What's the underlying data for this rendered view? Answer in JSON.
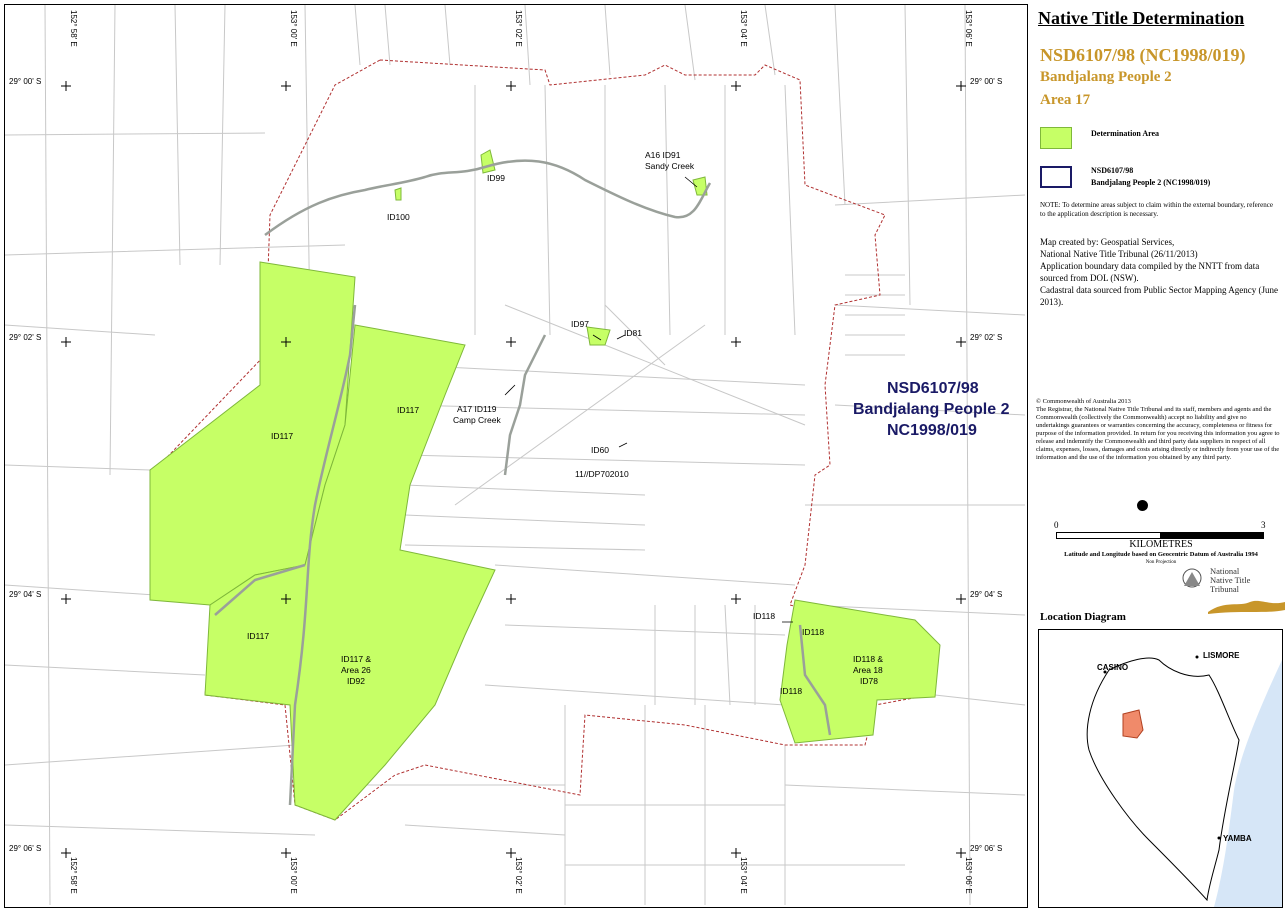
{
  "panel": {
    "title": "Native Title Determination",
    "application_number": "NSD6107/98 (NC1998/019)",
    "claim_name": "Bandjalang People 2",
    "area": "Area 17",
    "legend": {
      "determination_area": "Determination Area",
      "claim_boundary_line1": "NSD6107/98",
      "claim_boundary_line2": "Bandjalang People 2 (NC1998/019)"
    },
    "note": "NOTE: To determine areas subject to claim within the external boundary, reference to the application description is necessary.",
    "credits": [
      "Map created by: Geospatial Services,",
      "National Native Title Tribunal   (26/11/2013)",
      "Application boundary data compiled by the NNTT from data sourced from DOL (NSW).",
      "Cadastral data sourced from Public Sector Mapping Agency (June 2013)."
    ],
    "copyright_title": "© Commonwealth of Australia 2013",
    "copyright_text": "The Registrar, the National Native Title Tribunal and its staff, members and agents and the Commonwealth (collectively the Commonwealth) accept no liability and give no undertakings guarantees or warranties concerning the accuracy, completeness or fitness for purpose of the information provided. In return for you receiving this information you agree to release and indemnify the Commonwealth and third party data suppliers in respect of all claims, expenses, losses, damages and costs arising directly or indirectly from your use of the information and the use of the information you obtained by any third party.",
    "scale": {
      "min": "0",
      "max": "3",
      "unit": "KILOMETRES",
      "datum": "Latitude and Longitude based on Geocentric Datum of Australia 1994",
      "projection": "Non Projection"
    },
    "logo_text": [
      "National",
      "Native Title",
      "Tribunal"
    ],
    "location_title": "Location Diagram",
    "location_labels": {
      "casino": "CASINO",
      "lismore": "LISMORE",
      "yamba": "YAMBA"
    }
  },
  "map": {
    "claim_label": [
      "NSD6107/98",
      "Bandjalang People 2",
      "NC1998/019"
    ],
    "lat_labels": [
      "29° 00' S",
      "29° 02' S",
      "29° 04' S",
      "29° 06' S"
    ],
    "lon_labels": [
      "152° 58' E",
      "153° 00' E",
      "153° 02' E",
      "153° 04' E",
      "153° 06' E"
    ],
    "parcel_labels": {
      "id100": "ID100",
      "id99": "ID99",
      "a16_line1": "A16 ID91",
      "a16_line2": "Sandy Creek",
      "id97": "ID97",
      "id81": "ID81",
      "id117_w": "ID117",
      "id117_n": "ID117",
      "a17_line1": "A17 ID119",
      "a17_line2": "Camp Creek",
      "id60": "ID60",
      "lot": "11//DP702010",
      "id117_sw": "ID117",
      "id117_area26_line1": "ID117 &",
      "id117_area26_line2": "Area 26",
      "id117_area26_line3": "ID92",
      "id118_a": "ID118",
      "id118_b": "ID118",
      "id118_c": "ID118",
      "id118_area18_line1": "ID118 &",
      "id118_area18_line2": "Area 18",
      "id118_area18_line3": "ID78"
    }
  },
  "colors": {
    "determination_fill": "#c6ff66",
    "claim_outline": "#1a1a66",
    "boundary_dashed": "#b03030",
    "title_accent": "#c8962a",
    "location_fill": "#f08a6a",
    "sea": "#d6e6f7"
  }
}
